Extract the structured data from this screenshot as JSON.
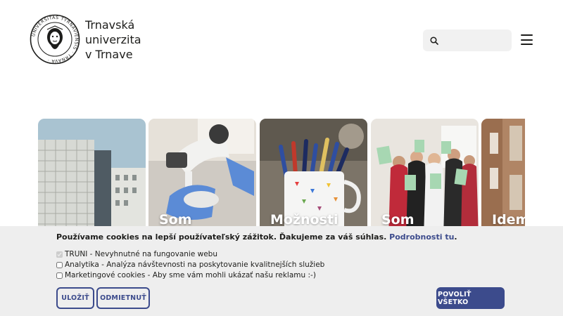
{
  "header": {
    "logo": {
      "line1": "Trnavská",
      "line2": "univerzita",
      "line3": "v Trnave",
      "seal_text": "UNIVERSITAS TYRNAVIENSIS · TRNAVA"
    },
    "search": {
      "icon": "search-icon",
      "placeholder": ""
    },
    "menu": {
      "icon": "hamburger-menu-icon"
    }
  },
  "cards": [
    {
      "title": "",
      "scene": "university-building"
    },
    {
      "title": "Som",
      "scene": "microscope-lab"
    },
    {
      "title": "Možnosti",
      "scene": "mug-of-pens"
    },
    {
      "title": "Som",
      "scene": "graduates-with-diplomas"
    },
    {
      "title": "Idem",
      "scene": "building-facade"
    }
  ],
  "cookie_banner": {
    "message": "Používame cookies na lepší používateľský zážitok. Ďakujeme za váš súhlas.",
    "link_text": "Podrobnosti tu",
    "link_suffix": ".",
    "options": [
      {
        "label": "TRUNI - Nevyhnutné na fungovanie webu",
        "checked": true,
        "disabled": true
      },
      {
        "label": "Analytika - Analýza návštevnosti na poskytovanie kvalitnejších služieb",
        "checked": false,
        "disabled": false
      },
      {
        "label": "Marketingové cookies - Aby sme vám mohli ukázať našu reklamu :-)",
        "checked": false,
        "disabled": false
      }
    ],
    "buttons": {
      "save": "ULOŽIŤ",
      "reject": "ODMIETNUŤ",
      "allow_all": "POVOLIŤ VŠETKO"
    }
  },
  "colors": {
    "accent": "#3c4b8c",
    "banner_bg": "#eeeeee",
    "text": "#1d1d1b",
    "search_bg": "#f1f1f1"
  }
}
